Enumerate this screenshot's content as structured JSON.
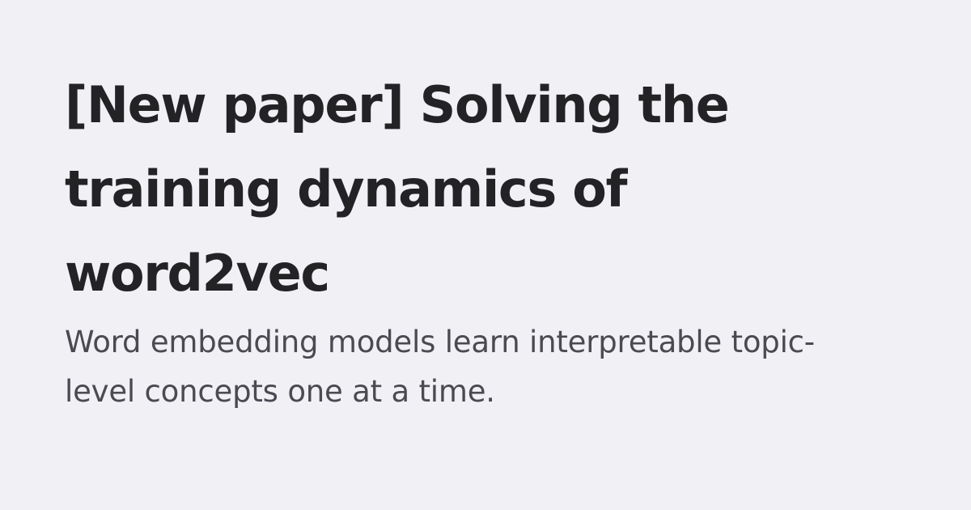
{
  "card": {
    "title": "[New paper] Solving the training dynamics of word2vec",
    "subtitle": "Word embedding models learn interpretable topic-level concepts one at a time."
  },
  "colors": {
    "background": "#f1f0f5",
    "title_text": "#232225",
    "subtitle_text": "#4b4a52"
  }
}
